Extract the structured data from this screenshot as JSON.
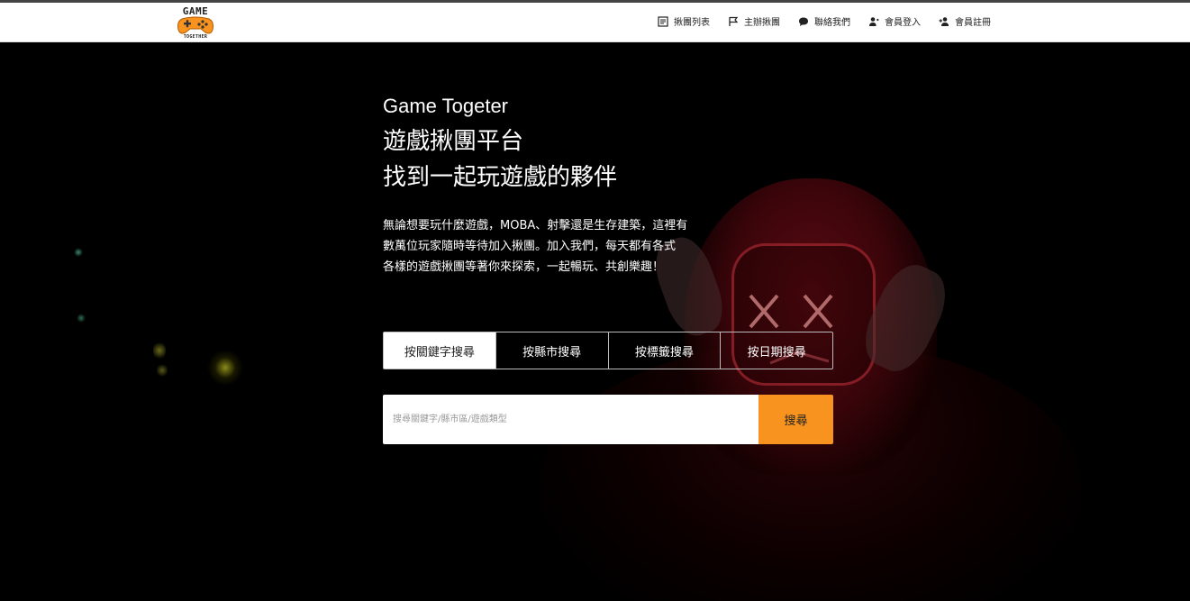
{
  "logo": {
    "top_text": "GAME",
    "bottom_text": "TOGETHER"
  },
  "nav": {
    "items": [
      {
        "label": "揪團列表",
        "icon": "list-icon"
      },
      {
        "label": "主辦揪團",
        "icon": "flag-icon"
      },
      {
        "label": "聯絡我們",
        "icon": "chat-bubble-icon"
      },
      {
        "label": "會員登入",
        "icon": "user-login-icon"
      },
      {
        "label": "會員註冊",
        "icon": "user-add-icon"
      }
    ]
  },
  "hero": {
    "brand": "Game Togeter",
    "tagline_line1": "遊戲揪團平台",
    "tagline_line2": "找到一起玩遊戲的夥伴",
    "desc_line1": "無論想要玩什麼遊戲，MOBA、射擊還是生存建築，這裡有",
    "desc_line2": "數萬位玩家隨時等待加入揪團。加入我們，每天都有各式",
    "desc_line3": "各樣的遊戲揪團等著你來探索，一起暢玩、共創樂趣！"
  },
  "search_tabs": [
    {
      "label": "按關鍵字搜尋",
      "active": true
    },
    {
      "label": "按縣市搜尋",
      "active": false
    },
    {
      "label": "按標籤搜尋",
      "active": false
    },
    {
      "label": "按日期搜尋",
      "active": false
    }
  ],
  "search": {
    "placeholder": "搜尋關鍵字/縣市區/遊戲類型",
    "button_label": "搜尋"
  },
  "colors": {
    "accent": "#f7931e",
    "background": "#000000",
    "navbar": "#ffffff"
  }
}
